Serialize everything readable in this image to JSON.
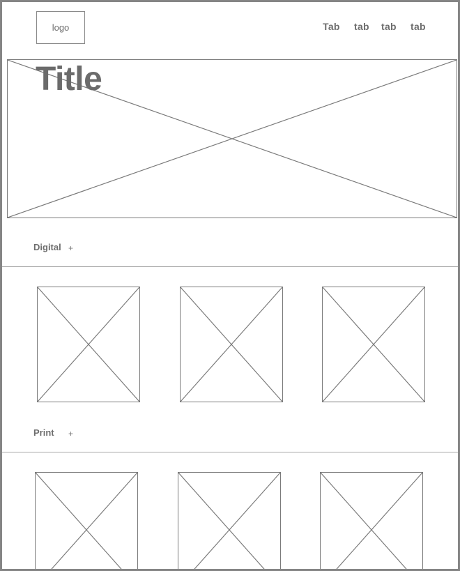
{
  "header": {
    "logo_text": "logo",
    "tabs": [
      {
        "label": "Tab"
      },
      {
        "label": "tab"
      },
      {
        "label": "tab"
      },
      {
        "label": "tab"
      }
    ]
  },
  "hero": {
    "title": "Title"
  },
  "sections": [
    {
      "label": "Digital",
      "toggle_icon": "plus-icon",
      "toggle_glyph": "+"
    },
    {
      "label": "Print",
      "toggle_icon": "plus-icon",
      "toggle_glyph": "+"
    }
  ],
  "colors": {
    "line": "#7a7a7a",
    "text": "#6e6e6e",
    "frame": "#858585"
  }
}
